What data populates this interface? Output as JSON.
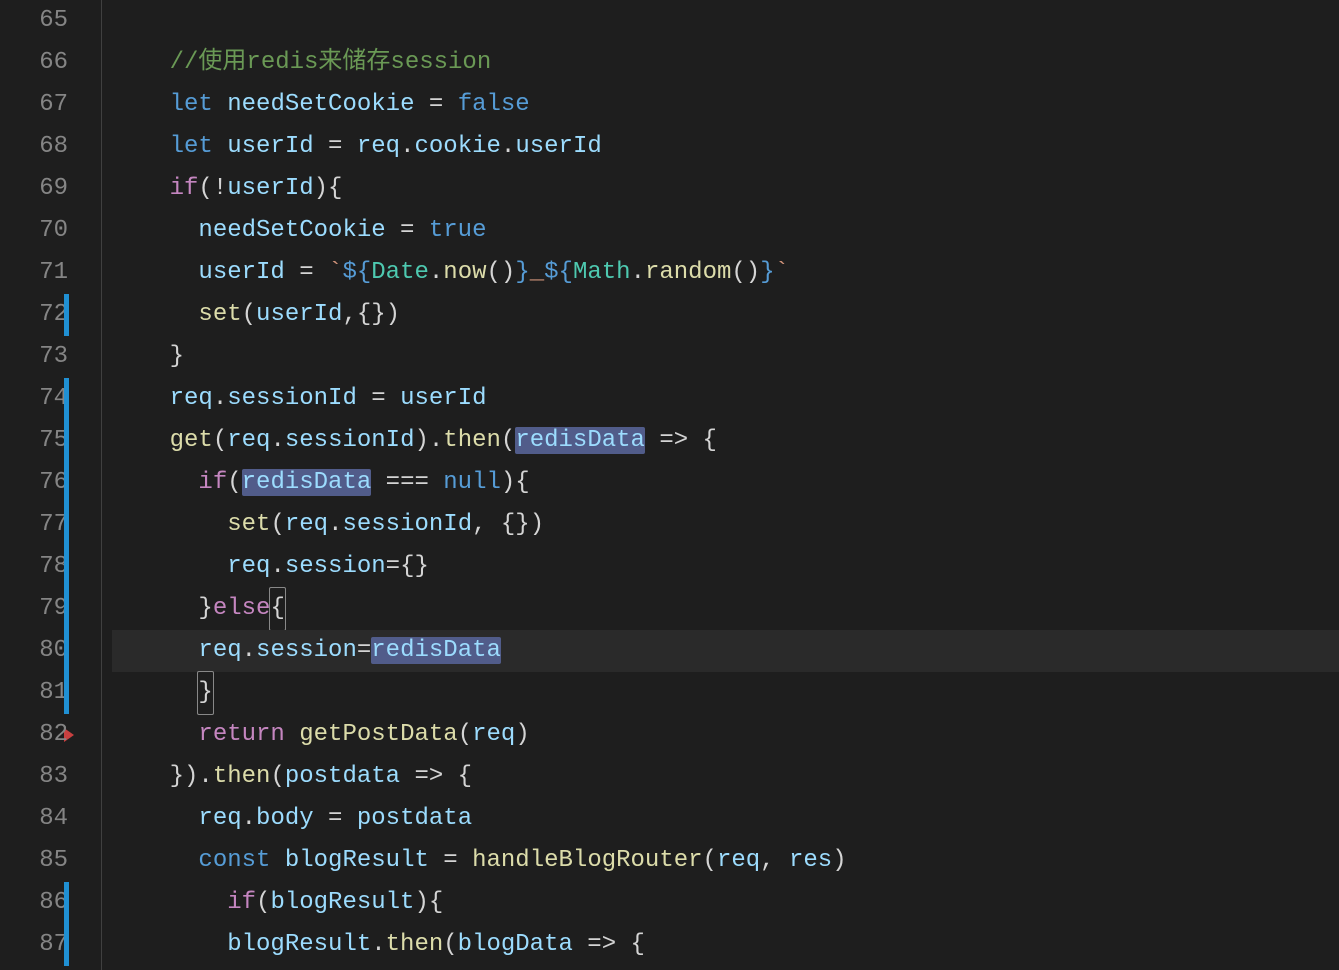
{
  "editor": {
    "startLine": 65,
    "currentLine": 80,
    "modifiedLines": [
      72,
      74,
      75,
      76,
      77,
      78,
      79,
      80,
      81,
      86,
      87
    ],
    "breakpointIndicatorAfter": 81,
    "highlightedWord": "redisData",
    "lines": {
      "l65": {
        "num": "65"
      },
      "l66": {
        "num": "66",
        "comment": "//使用redis来储存session",
        "indent": "    "
      },
      "l67": {
        "num": "67",
        "indent": "    ",
        "kw_let": "let",
        "var_needSetCookie": "needSetCookie",
        "op": " = ",
        "val_false": "false"
      },
      "l68": {
        "num": "68",
        "indent": "    ",
        "kw_let": "let",
        "var_userId": "userId",
        "op": " = ",
        "req": "req",
        "dot1": ".",
        "cookie": "cookie",
        "dot2": ".",
        "userId": "userId"
      },
      "l69": {
        "num": "69",
        "indent": "    ",
        "kw_if": "if",
        "p1": "(!",
        "var": "userId",
        "p2": "){"
      },
      "l70": {
        "num": "70",
        "indent": "      ",
        "var": "needSetCookie",
        "op": " = ",
        "val": "true"
      },
      "l71": {
        "num": "71",
        "indent": "      ",
        "var": "userId",
        "op": " = ",
        "bt1": "`",
        "t1": "${",
        "obj1": "Date",
        "dot1": ".",
        "m1": "now",
        "p1": "()",
        "t2": "}",
        "us": "_",
        "t3": "${",
        "obj2": "Math",
        "dot2": ".",
        "m2": "random",
        "p2": "()",
        "t4": "}",
        "bt2": "`"
      },
      "l72": {
        "num": "72",
        "indent": "      ",
        "fn": "set",
        "p1": "(",
        "var": "userId",
        "c": ",{})"
      },
      "l73": {
        "num": "73",
        "indent": "    ",
        "brace": "}"
      },
      "l74": {
        "num": "74",
        "indent": "    ",
        "req": "req",
        "dot": ".",
        "sid": "sessionId",
        "op": " = ",
        "var": "userId"
      },
      "l75": {
        "num": "75",
        "indent": "    ",
        "fn_get": "get",
        "p1": "(",
        "req": "req",
        "dot1": ".",
        "sid": "sessionId",
        "p2": ").",
        "fn_then": "then",
        "p3": "(",
        "param": "redisData",
        "arrow": " => {"
      },
      "l76": {
        "num": "76",
        "indent": "      ",
        "kw_if": "if",
        "p1": "(",
        "var": "redisData",
        "op": " === ",
        "null": "null",
        "p2": "){"
      },
      "l77": {
        "num": "77",
        "indent": "        ",
        "fn": "set",
        "p1": "(",
        "req": "req",
        "dot": ".",
        "sid": "sessionId",
        "c": ", {})"
      },
      "l78": {
        "num": "78",
        "indent": "        ",
        "req": "req",
        "dot": ".",
        "sess": "session",
        "op": "={}"
      },
      "l79": {
        "num": "79",
        "indent": "      ",
        "b1": "}",
        "kw_else": "else",
        "b2": "{"
      },
      "l80": {
        "num": "80",
        "indent": "      ",
        "req": "req",
        "dot": ".",
        "sess": "session",
        "op": "=",
        "var": "redisData"
      },
      "l81": {
        "num": "81",
        "indent": "      ",
        "brace": "}"
      },
      "l82": {
        "num": "82",
        "indent": "      ",
        "kw_return": "return",
        "sp": " ",
        "fn": "getPostData",
        "p1": "(",
        "req": "req",
        "p2": ")"
      },
      "l83": {
        "num": "83",
        "indent": "    ",
        "b1": "}).",
        "fn_then": "then",
        "p1": "(",
        "param": "postdata",
        "arrow": " => {"
      },
      "l84": {
        "num": "84",
        "indent": "      ",
        "req": "req",
        "dot": ".",
        "body": "body",
        "op": " = ",
        "var": "postdata"
      },
      "l85": {
        "num": "85",
        "indent": "      ",
        "kw_const": "const",
        "sp": " ",
        "var": "blogResult",
        "op": " = ",
        "fn": "handleBlogRouter",
        "p1": "(",
        "req": "req",
        "c": ", ",
        "res": "res",
        "p2": ")"
      },
      "l86": {
        "num": "86",
        "indent": "        ",
        "kw_if": "if",
        "p1": "(",
        "var": "blogResult",
        "p2": "){"
      },
      "l87": {
        "num": "87",
        "indent": "        ",
        "var": "blogResult",
        "dot": ".",
        "fn": "then",
        "p1": "(",
        "param": "blogData",
        "arrow": " => {"
      }
    }
  }
}
